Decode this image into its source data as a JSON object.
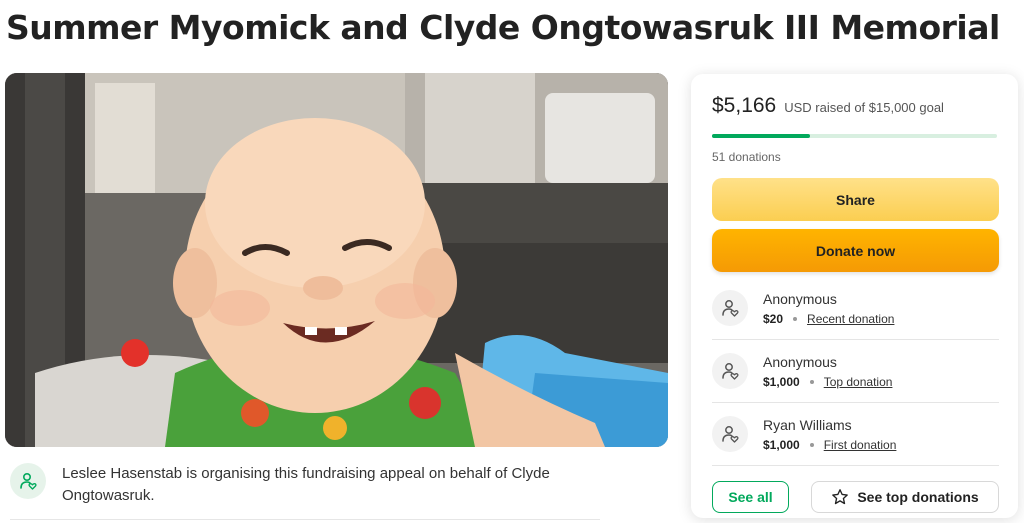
{
  "page": {
    "title": "Summer Myomick and Clyde Ongtowasruk III Memorial"
  },
  "organiser": {
    "text": "Leslee Hasenstab is organising this fundraising appeal on behalf of Clyde Ongtowasruk."
  },
  "card": {
    "raised": "$5,166",
    "goal_text": "USD raised of $15,000 goal",
    "progress_fraction": 0.344,
    "donations_count": "51 donations",
    "share_label": "Share",
    "donate_label": "Donate now",
    "donors": [
      {
        "name": "Anonymous",
        "amount": "$20",
        "tag": "Recent donation"
      },
      {
        "name": "Anonymous",
        "amount": "$1,000",
        "tag": "Top donation"
      },
      {
        "name": "Ryan Williams",
        "amount": "$1,000",
        "tag": "First donation"
      }
    ],
    "see_all_label": "See all",
    "see_top_label": "See top donations"
  },
  "colors": {
    "accent_green": "#02a95c",
    "share_yellow": "#fbce51",
    "donate_orange": "#f59a05"
  },
  "icons": {
    "organiser": "heart-person-icon",
    "donor": "heart-person-icon",
    "top": "star-icon"
  }
}
